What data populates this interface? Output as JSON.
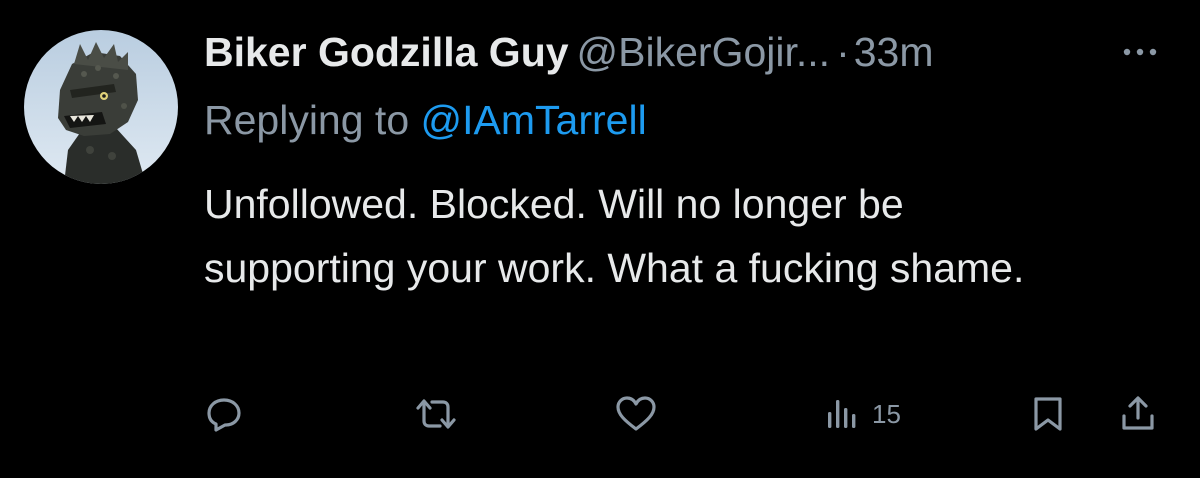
{
  "tweet": {
    "display_name": "Biker Godzilla Guy",
    "handle": "@BikerGojir...",
    "separator": "·",
    "time": "33m",
    "reply_prefix": "Replying to",
    "reply_to": "@IAmTarrell",
    "text": "Unfollowed. Blocked. Will no longer be supporting your work. What a fucking shame."
  },
  "actions": {
    "views": "15",
    "icons": [
      "reply-icon",
      "retweet-icon",
      "like-icon",
      "views-icon",
      "bookmark-icon",
      "share-icon"
    ]
  },
  "colors": {
    "background": "#000000",
    "text": "#e7e9ea",
    "secondary": "#8b98a5",
    "link": "#1d9bf0"
  }
}
